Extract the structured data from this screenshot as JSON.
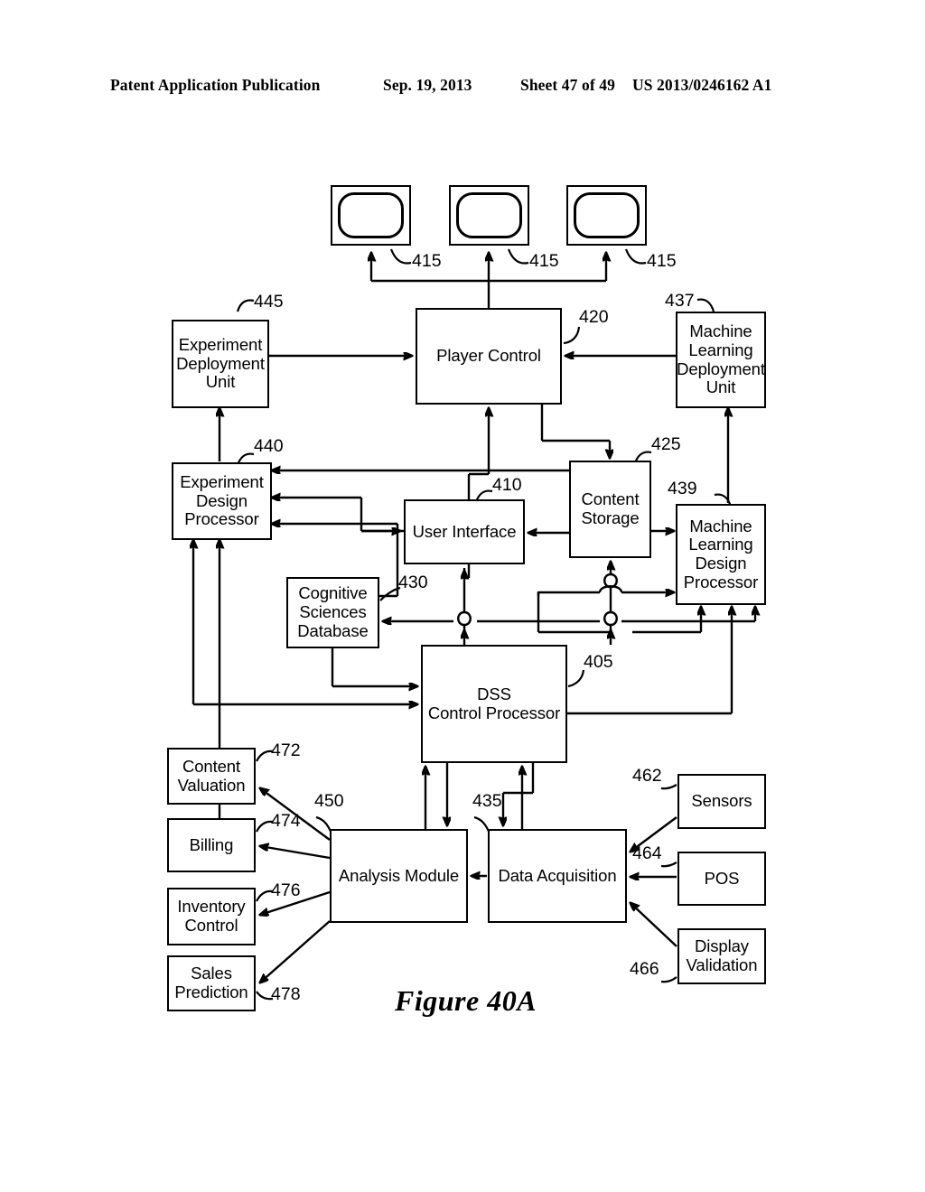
{
  "header": {
    "publication": "Patent Application Publication",
    "date": "Sep. 19, 2013",
    "sheet": "Sheet 47 of 49",
    "number": "US 2013/0246162 A1"
  },
  "figure": {
    "caption": "Figure 40A",
    "title": "Decision support system block diagram"
  },
  "displays": [
    {
      "id": "display-1",
      "ref": "415"
    },
    {
      "id": "display-2",
      "ref": "415"
    },
    {
      "id": "display-3",
      "ref": "415"
    }
  ],
  "blocks": [
    {
      "id": "experiment-deployment-unit",
      "label": "Experiment\nDeployment\nUnit",
      "lines": [
        "Experiment",
        "Deployment",
        "Unit"
      ],
      "ref": "445"
    },
    {
      "id": "player-control",
      "label": "Player Control",
      "lines": [
        "Player Control"
      ],
      "ref": "420"
    },
    {
      "id": "machine-learning-deployment-unit",
      "label": "Machine\nLearning\nDeployment\nUnit",
      "lines": [
        "Machine",
        "Learning",
        "Deployment",
        "Unit"
      ],
      "ref": "437"
    },
    {
      "id": "experiment-design-processor",
      "label": "Experiment\nDesign\nProcessor",
      "lines": [
        "Experiment",
        "Design",
        "Processor"
      ],
      "ref": "440"
    },
    {
      "id": "user-interface",
      "label": "User Interface",
      "lines": [
        "User Interface"
      ],
      "ref": "410"
    },
    {
      "id": "content-storage",
      "label": "Content\nStorage",
      "lines": [
        "Content",
        "Storage"
      ],
      "ref": "425"
    },
    {
      "id": "machine-learning-design-processor",
      "label": "Machine\nLearning\nDesign\nProcessor",
      "lines": [
        "Machine",
        "Learning",
        "Design",
        "Processor"
      ],
      "ref": "439"
    },
    {
      "id": "cognitive-sciences-database",
      "label": "Cognitive\nSciences\nDatabase",
      "lines": [
        "Cognitive",
        "Sciences",
        "Database"
      ],
      "ref": "430"
    },
    {
      "id": "dss-control-processor",
      "label": "DSS\nControl Processor",
      "lines": [
        "DSS",
        "Control Processor"
      ],
      "ref": "405"
    },
    {
      "id": "content-valuation",
      "label": "Content\nValuation",
      "lines": [
        "Content",
        "Valuation"
      ],
      "ref": "472"
    },
    {
      "id": "billing",
      "label": "Billing",
      "lines": [
        "Billing"
      ],
      "ref": "474"
    },
    {
      "id": "inventory-control",
      "label": "Inventory\nControl",
      "lines": [
        "Inventory",
        "Control"
      ],
      "ref": "476"
    },
    {
      "id": "sales-prediction",
      "label": "Sales\nPrediction",
      "lines": [
        "Sales",
        "Prediction"
      ],
      "ref": "478"
    },
    {
      "id": "analysis-module",
      "label": "Analysis Module",
      "lines": [
        "Analysis Module"
      ],
      "ref": "450"
    },
    {
      "id": "data-acquisition",
      "label": "Data Acquisition",
      "lines": [
        "Data Acquisition"
      ],
      "ref": "435"
    },
    {
      "id": "sensors",
      "label": "Sensors",
      "lines": [
        "Sensors"
      ],
      "ref": "462"
    },
    {
      "id": "pos",
      "label": "POS",
      "lines": [
        "POS"
      ],
      "ref": "464"
    },
    {
      "id": "display-validation",
      "label": "Display\nValidation",
      "lines": [
        "Display",
        "Validation"
      ],
      "ref": "466"
    }
  ],
  "labels": {
    "experiment_deployment_unit_l1": "Experiment",
    "experiment_deployment_unit_l2": "Deployment",
    "experiment_deployment_unit_l3": "Unit",
    "player_control": "Player Control",
    "ml_deployment_unit_l1": "Machine",
    "ml_deployment_unit_l2": "Learning",
    "ml_deployment_unit_l3": "Deployment",
    "ml_deployment_unit_l4": "Unit",
    "experiment_design_processor_l1": "Experiment",
    "experiment_design_processor_l2": "Design",
    "experiment_design_processor_l3": "Processor",
    "user_interface": "User Interface",
    "content_storage_l1": "Content",
    "content_storage_l2": "Storage",
    "ml_design_processor_l1": "Machine",
    "ml_design_processor_l2": "Learning",
    "ml_design_processor_l3": "Design",
    "ml_design_processor_l4": "Processor",
    "cognitive_sciences_database_l1": "Cognitive",
    "cognitive_sciences_database_l2": "Sciences",
    "cognitive_sciences_database_l3": "Database",
    "dss_control_processor_l1": "DSS",
    "dss_control_processor_l2": "Control Processor",
    "content_valuation_l1": "Content",
    "content_valuation_l2": "Valuation",
    "billing": "Billing",
    "inventory_control_l1": "Inventory",
    "inventory_control_l2": "Control",
    "sales_prediction_l1": "Sales",
    "sales_prediction_l2": "Prediction",
    "analysis_module": "Analysis Module",
    "data_acquisition": "Data Acquisition",
    "sensors": "Sensors",
    "pos": "POS",
    "display_validation_l1": "Display",
    "display_validation_l2": "Validation"
  },
  "refs": {
    "r415a": "415",
    "r415b": "415",
    "r415c": "415",
    "r445": "445",
    "r420": "420",
    "r437": "437",
    "r440": "440",
    "r410": "410",
    "r425": "425",
    "r439": "439",
    "r430": "430",
    "r405": "405",
    "r472": "472",
    "r474": "474",
    "r476": "476",
    "r478": "478",
    "r450": "450",
    "r435": "435",
    "r462": "462",
    "r464": "464",
    "r466": "466"
  },
  "colors": {
    "ink": "#000000",
    "paper": "#ffffff"
  }
}
